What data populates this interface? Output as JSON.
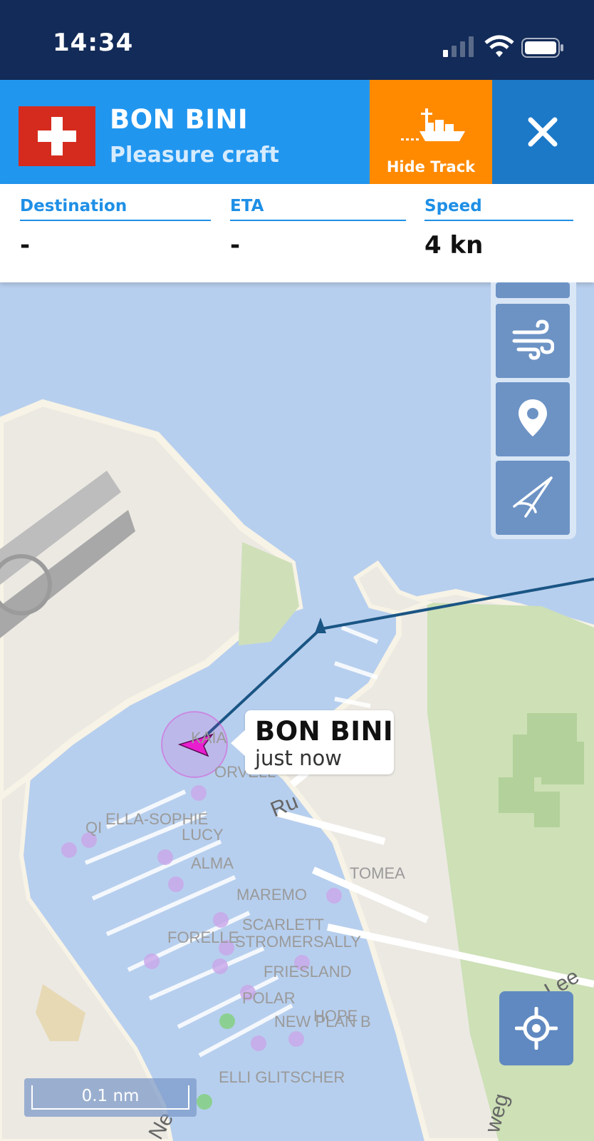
{
  "status_bar": {
    "time": "14:34"
  },
  "vessel": {
    "name": "BON BINI",
    "type": "Pleasure craft",
    "flag": "switzerland-flag",
    "hide_track_label": "Hide Track",
    "info": [
      {
        "label": "Destination",
        "value": "-"
      },
      {
        "label": "ETA",
        "value": "-"
      },
      {
        "label": "Speed",
        "value": "4 kn"
      }
    ]
  },
  "callout": {
    "name": "BON BINI",
    "time": "just now"
  },
  "map_labels": {
    "vessels": [
      "KAIA",
      "ORVELL",
      "QI",
      "ELLA-SOPHIE",
      "LUCY",
      "ALMA",
      "TOMEA",
      "MAREMO",
      "SCARLETT",
      "FORELLE",
      "STROMER",
      "SALLY",
      "FRIESLAND",
      "POLAR",
      "NEW PLAN B",
      "HOPE",
      "ELLI GLITSCHER"
    ],
    "roads": [
      "Ru",
      "Lee",
      "weg",
      "Ne"
    ]
  },
  "tools": [
    "layers-icon",
    "wind-icon",
    "pin-icon",
    "measure-icon"
  ],
  "scale": "0.1 nm",
  "colors": {
    "status_bar": "#132b58",
    "header": "#2196ef",
    "hide_track": "#ff8a00",
    "close": "#1c79c8",
    "water": "#b7cfee",
    "land": "#ece9e3",
    "park": "#cde0b6",
    "track": "#1a5584",
    "vessel_marker": "#e81ecf"
  }
}
